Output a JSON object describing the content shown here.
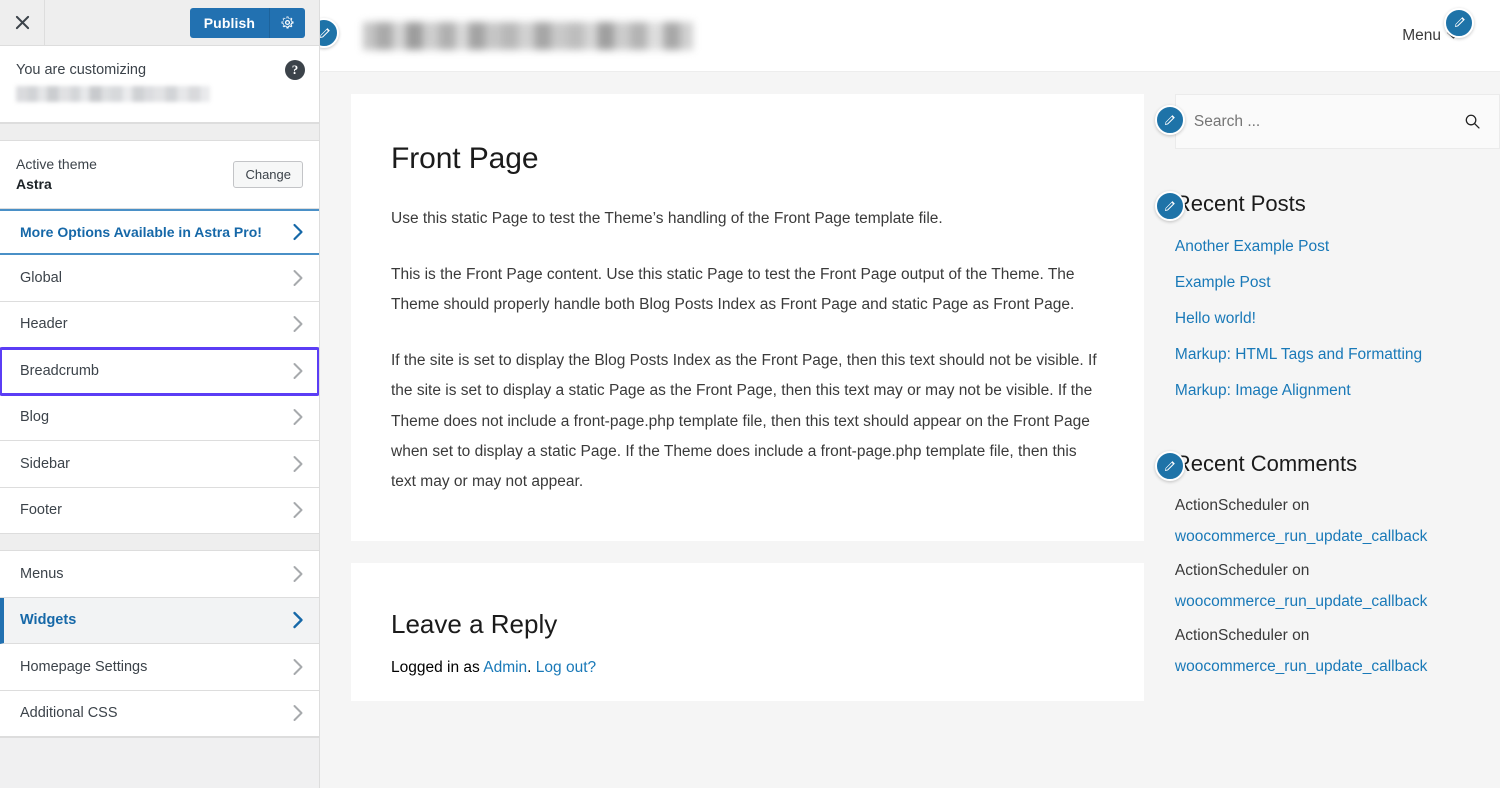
{
  "customizer": {
    "close_label": "Close customizer",
    "publish_label": "Publish",
    "gear_label": "Publish settings",
    "help_label": "?",
    "info_label": "You are customizing",
    "site_name_blurred": "",
    "theme_caption": "Active theme",
    "theme_name": "Astra",
    "change_label": "Change",
    "pro_row": {
      "label": "More Options Available in Astra Pro!"
    },
    "sections_group_a": [
      {
        "label": "Global",
        "state": "normal"
      },
      {
        "label": "Header",
        "state": "normal"
      },
      {
        "label": "Breadcrumb",
        "state": "focused"
      },
      {
        "label": "Blog",
        "state": "normal"
      },
      {
        "label": "Sidebar",
        "state": "normal"
      },
      {
        "label": "Footer",
        "state": "normal"
      }
    ],
    "sections_group_b": [
      {
        "label": "Menus",
        "state": "normal"
      },
      {
        "label": "Widgets",
        "state": "active"
      },
      {
        "label": "Homepage Settings",
        "state": "normal"
      },
      {
        "label": "Additional CSS",
        "state": "normal"
      }
    ],
    "colors": {
      "publish_blue": "#2271b1",
      "focus_outline": "#5b3df5",
      "active_blue": "#1668a8",
      "pro_border": "#4a90c7"
    }
  },
  "preview": {
    "header": {
      "site_title_blurred": "",
      "menu_label": "Menu",
      "edit_pin_label": "Edit site title"
    },
    "page": {
      "title": "Front Page",
      "paragraphs": [
        "Use this static Page to test the Theme’s handling of the Front Page template file.",
        "This is the Front Page content. Use this static Page to test the Front Page output of the Theme. The Theme should properly handle both Blog Posts Index as Front Page and static Page as Front Page.",
        "If the site is set to display the Blog Posts Index as the Front Page, then this text should not be visible. If the site is set to display a static Page as the Front Page, then this text may or may not be visible. If the Theme does not include a front-page.php template file, then this text should appear on the Front Page when set to display a static Page. If the Theme does include a front-page.php template file, then this text may or may not appear."
      ]
    },
    "comments_form": {
      "title": "Leave a Reply",
      "logged_in_prefix": "Logged in as ",
      "user_link": "Admin",
      "separator": ". ",
      "logout_link": "Log out?"
    },
    "sidebar": {
      "search": {
        "placeholder": "Search ...",
        "value": "",
        "icon": "search-icon"
      },
      "recent_posts": {
        "title": "Recent Posts",
        "items": [
          "Another Example Post",
          "Example Post",
          "Hello world!",
          "Markup: HTML Tags and Formatting",
          "Markup: Image Alignment"
        ]
      },
      "recent_comments": {
        "title": "Recent Comments",
        "items": [
          {
            "author": "ActionScheduler",
            "on": " on",
            "post": "woocommerce_run_update_callback"
          },
          {
            "author": "ActionScheduler",
            "on": " on",
            "post": "woocommerce_run_update_callback"
          },
          {
            "author": "ActionScheduler",
            "on": " on",
            "post": "woocommerce_run_update_callback"
          }
        ]
      }
    },
    "colors": {
      "link_blue": "#1979b8",
      "edit_pin_blue": "#1e73a8",
      "page_bg": "#f5f5f5",
      "card_bg": "#ffffff"
    }
  }
}
